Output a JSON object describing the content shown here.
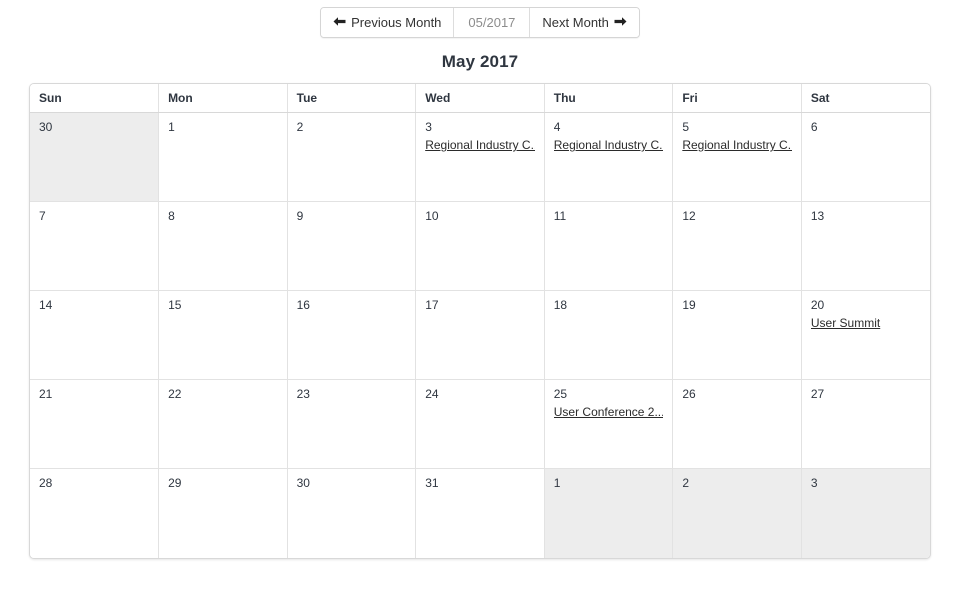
{
  "toolbar": {
    "previous_label": "Previous Month",
    "previous_icon": "arrow-left-icon",
    "previous_arrow": "←",
    "month_value": "05/2017",
    "next_label": "Next Month",
    "next_icon": "arrow-right-icon",
    "next_arrow": "→"
  },
  "calendar": {
    "title": "May 2017",
    "weekday_headers": [
      "Sun",
      "Mon",
      "Tue",
      "Wed",
      "Thu",
      "Fri",
      "Sat"
    ],
    "weeks": [
      [
        {
          "day": "30",
          "other_month": true,
          "events": []
        },
        {
          "day": "1",
          "other_month": false,
          "events": []
        },
        {
          "day": "2",
          "other_month": false,
          "events": []
        },
        {
          "day": "3",
          "other_month": false,
          "events": [
            "Regional Industry C.."
          ]
        },
        {
          "day": "4",
          "other_month": false,
          "events": [
            "Regional Industry C.."
          ]
        },
        {
          "day": "5",
          "other_month": false,
          "events": [
            "Regional Industry C.."
          ]
        },
        {
          "day": "6",
          "other_month": false,
          "events": []
        }
      ],
      [
        {
          "day": "7",
          "other_month": false,
          "events": []
        },
        {
          "day": "8",
          "other_month": false,
          "events": []
        },
        {
          "day": "9",
          "other_month": false,
          "events": []
        },
        {
          "day": "10",
          "other_month": false,
          "events": []
        },
        {
          "day": "11",
          "other_month": false,
          "events": []
        },
        {
          "day": "12",
          "other_month": false,
          "events": []
        },
        {
          "day": "13",
          "other_month": false,
          "events": []
        }
      ],
      [
        {
          "day": "14",
          "other_month": false,
          "events": []
        },
        {
          "day": "15",
          "other_month": false,
          "events": []
        },
        {
          "day": "16",
          "other_month": false,
          "events": []
        },
        {
          "day": "17",
          "other_month": false,
          "events": []
        },
        {
          "day": "18",
          "other_month": false,
          "events": []
        },
        {
          "day": "19",
          "other_month": false,
          "events": []
        },
        {
          "day": "20",
          "other_month": false,
          "events": [
            "User Summit"
          ]
        }
      ],
      [
        {
          "day": "21",
          "other_month": false,
          "events": []
        },
        {
          "day": "22",
          "other_month": false,
          "events": []
        },
        {
          "day": "23",
          "other_month": false,
          "events": []
        },
        {
          "day": "24",
          "other_month": false,
          "events": []
        },
        {
          "day": "25",
          "other_month": false,
          "events": [
            "User Conference 2..."
          ]
        },
        {
          "day": "26",
          "other_month": false,
          "events": []
        },
        {
          "day": "27",
          "other_month": false,
          "events": []
        }
      ],
      [
        {
          "day": "28",
          "other_month": false,
          "events": []
        },
        {
          "day": "29",
          "other_month": false,
          "events": []
        },
        {
          "day": "30",
          "other_month": false,
          "events": []
        },
        {
          "day": "31",
          "other_month": false,
          "events": []
        },
        {
          "day": "1",
          "other_month": true,
          "events": []
        },
        {
          "day": "2",
          "other_month": true,
          "events": []
        },
        {
          "day": "3",
          "other_month": true,
          "events": []
        }
      ]
    ]
  },
  "colors": {
    "text": "#2f3640",
    "muted": "#8c8c8c",
    "border": "#d8d8d8",
    "cell_border": "#e2e2e2",
    "other_month_bg": "#ededed",
    "page_bg": "#ffffff"
  }
}
